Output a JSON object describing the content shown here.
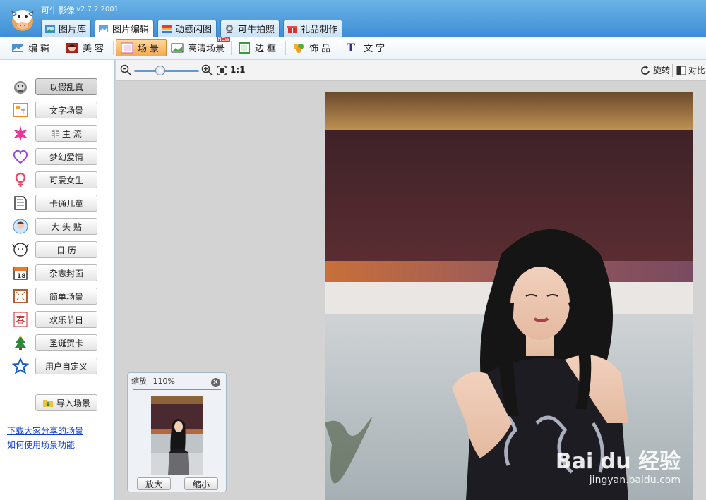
{
  "app": {
    "title": "可牛影像",
    "version": "v2.7.2.2001"
  },
  "tabs": [
    {
      "label": "图片库",
      "icon": "photo-library-icon"
    },
    {
      "label": "图片编辑",
      "icon": "image-edit-icon",
      "active": true
    },
    {
      "label": "动感闪图",
      "icon": "flash-image-icon"
    },
    {
      "label": "可牛拍照",
      "icon": "webcam-icon"
    },
    {
      "label": "礼品制作",
      "icon": "gift-icon"
    }
  ],
  "toolbar": [
    {
      "label": "编辑",
      "icon": "edit-icon"
    },
    {
      "label": "美容",
      "icon": "beauty-icon"
    },
    {
      "label": "场景",
      "icon": "scene-icon",
      "active": true
    },
    {
      "label": "高清场景",
      "icon": "hd-scene-icon",
      "badge": "NEW"
    },
    {
      "label": "边框",
      "icon": "frame-icon"
    },
    {
      "label": "饰品",
      "icon": "accessory-icon"
    },
    {
      "label": "文字",
      "icon": "text-icon"
    }
  ],
  "sidebar": {
    "categories": [
      {
        "label": "以假乱真",
        "icon": "cow-face-icon",
        "active": true
      },
      {
        "label": "文字场景",
        "icon": "text-scene-icon"
      },
      {
        "label": "非 主 流",
        "icon": "sparkle-icon"
      },
      {
        "label": "梦幻爱情",
        "icon": "heart-icon"
      },
      {
        "label": "可爱女生",
        "icon": "female-icon"
      },
      {
        "label": "卡通儿童",
        "icon": "book-icon"
      },
      {
        "label": "大 头 贴",
        "icon": "photo-sticker-icon"
      },
      {
        "label": "日  历",
        "icon": "calendar-cow-icon"
      },
      {
        "label": "杂志封面",
        "icon": "calendar-icon"
      },
      {
        "label": "简单场景",
        "icon": "simple-frame-icon"
      },
      {
        "label": "欢乐节日",
        "icon": "spring-festival-icon"
      },
      {
        "label": "圣诞贺卡",
        "icon": "christmas-tree-icon"
      },
      {
        "label": "用户自定义",
        "icon": "star-icon"
      }
    ],
    "import_label": "导入场景",
    "links": [
      "下载大家分享的场景",
      "如何使用场景功能"
    ]
  },
  "zoombar": {
    "zoom_level": 0.4,
    "fit_label": "",
    "one_to_one": "1:1",
    "rotate_label": "旋转",
    "compare_label": "对比"
  },
  "zoom_panel": {
    "title": "缩放",
    "percent": "110%",
    "zoom_in": "放大",
    "zoom_out": "缩小"
  },
  "watermark": {
    "brand": "Bai du 经验",
    "url": "jingyan.baidu.com"
  },
  "colors": {
    "accent_blue": "#3f8fd4",
    "active_orange": "#f6a94a",
    "link": "#0c3fcc"
  }
}
